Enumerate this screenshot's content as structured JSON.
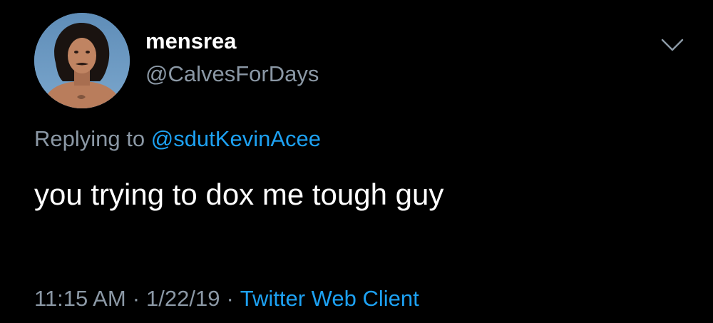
{
  "tweet": {
    "avatar_icon": "profile-photo-icon",
    "display_name": "mensrea",
    "handle": "@CalvesForDays",
    "menu_icon": "chevron-down-icon",
    "replying_prefix": "Replying to",
    "replying_to": "@sdutKevinAcee",
    "text": "you trying to dox me tough guy",
    "time": "11:15 AM",
    "separator": "·",
    "date": "1/22/19",
    "client": "Twitter Web Client"
  },
  "colors": {
    "background": "#000000",
    "primary_text": "#ffffff",
    "secondary_text": "#8b98a5",
    "link": "#1da1f2"
  }
}
